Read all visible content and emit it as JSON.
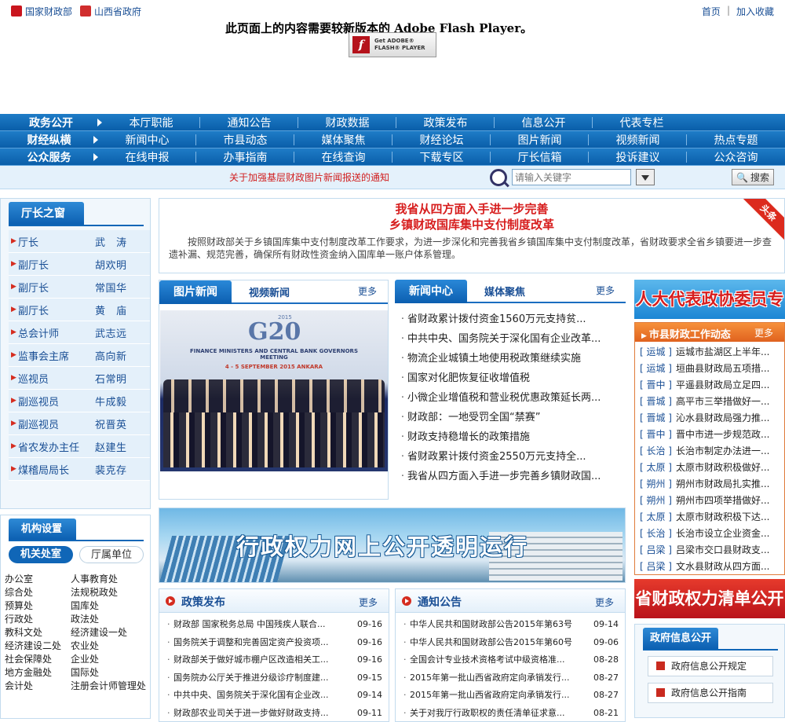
{
  "top": {
    "left_links": [
      "国家财政部",
      "山西省政府"
    ],
    "right_links": [
      "首页",
      "加入收藏"
    ],
    "separator": "|"
  },
  "flash": {
    "message": "此页面上的内容需要较新版本的 Adobe Flash Player。",
    "button_line1": "Get ADOBE®",
    "button_line2": "FLASH® PLAYER"
  },
  "nav": {
    "rows": [
      {
        "category": "政务公开",
        "items": [
          "本厅职能",
          "通知公告",
          "财政数据",
          "政策发布",
          "信息公开",
          "代表专栏"
        ]
      },
      {
        "category": "财经纵横",
        "items": [
          "新闻中心",
          "市县动态",
          "媒体聚焦",
          "财经论坛",
          "图片新闻",
          "视频新闻",
          "热点专题"
        ]
      },
      {
        "category": "公众服务",
        "items": [
          "在线申报",
          "办事指南",
          "在线查询",
          "下载专区",
          "厅长信箱",
          "投诉建议",
          "公众咨询"
        ]
      }
    ]
  },
  "search": {
    "notice": "关于加强基层财政图片新闻报送的通知",
    "placeholder": "请输入关键字",
    "button": "搜索"
  },
  "leaders": {
    "title": "厅长之窗",
    "rows": [
      {
        "role": "厅长",
        "name": "武　涛"
      },
      {
        "role": "副厅长",
        "name": "胡欢明"
      },
      {
        "role": "副厅长",
        "name": "常国华"
      },
      {
        "role": "副厅长",
        "name": "黄　庙"
      },
      {
        "role": "总会计师",
        "name": "武志远"
      },
      {
        "role": "监事会主席",
        "name": "高向新"
      },
      {
        "role": "巡视员",
        "name": "石常明"
      },
      {
        "role": "副巡视员",
        "name": "牛成毅"
      },
      {
        "role": "副巡视员",
        "name": "祝晋英"
      },
      {
        "role": "省农发办主任",
        "name": "赵建生"
      },
      {
        "role": "煤稽局局长",
        "name": "裴克存"
      }
    ]
  },
  "org": {
    "title": "机构设置",
    "tabs": [
      "机关处室",
      "厅属单位"
    ],
    "items": [
      "办公室",
      "人事教育处",
      "综合处",
      "法规税政处",
      "预算处",
      "国库处",
      "行政处",
      "政法处",
      "教科文处",
      "经济建设一处",
      "经济建设二处",
      "农业处",
      "社会保障处",
      "企业处",
      "地方金融处",
      "国际处",
      "会计处",
      "注册会计师管理处"
    ]
  },
  "headline": {
    "title1": "我省从四方面入手进一步完善",
    "title2": "乡镇财政国库集中支付制度改革",
    "body": "按照财政部关于乡镇国库集中支付制度改革工作要求，为进一步深化和完善我省乡镇国库集中支付制度改革，省财政要求全省乡镇要进一步查遗补漏、规范完善，确保所有财政性资金纳入国库单一账户体系管理。",
    "ribbon": "头条"
  },
  "pic_news": {
    "tab_active": "图片新闻",
    "tab_other": "视频新闻",
    "more": "更多",
    "photo_year": "2015",
    "photo_brand": "G20",
    "photo_caption1": "FINANCE MINISTERS AND CENTRAL BANK GOVERNORS MEETING",
    "photo_caption2": "4 - 5 SEPTEMBER 2015  ANKARA"
  },
  "news_center": {
    "tab_active": "新闻中心",
    "tab_other": "媒体聚焦",
    "more": "更多",
    "items": [
      "省财政累计拨付资金1560万元支持贫...",
      "中共中央、国务院关于深化国有企业改革...",
      "物流企业城镇土地使用税政策继续实施",
      "国家对化肥恢复征收增值税",
      "小微企业增值税和营业税优惠政策延长两...",
      "财政部：一地受罚全国“禁赛”",
      "财政支持稳增长的政策措施",
      "省财政累计拨付资金2550万元支持全...",
      "我省从四方面入手进一步完善乡镇财政国..."
    ]
  },
  "banner": {
    "text": "行政权力网上公开透明运行"
  },
  "policy": {
    "title": "政策发布",
    "more": "更多",
    "items": [
      {
        "title": "财政部 国家税务总局 中国残疾人联合...",
        "date": "09-16"
      },
      {
        "title": "国务院关于调整和完善固定资产投资项...",
        "date": "09-16"
      },
      {
        "title": "财政部关于做好城市棚户区改造相关工...",
        "date": "09-16"
      },
      {
        "title": "国务院办公厅关于推进分级诊疗制度建...",
        "date": "09-15"
      },
      {
        "title": "中共中央、国务院关于深化国有企业改...",
        "date": "09-14"
      },
      {
        "title": "财政部农业司关于进一步做好财政支持...",
        "date": "09-11"
      }
    ]
  },
  "notices": {
    "title": "通知公告",
    "more": "更多",
    "items": [
      {
        "title": "中华人民共和国财政部公告2015年第63号",
        "date": "09-14"
      },
      {
        "title": "中华人民共和国财政部公告2015年第60号",
        "date": "09-06"
      },
      {
        "title": "全国会计专业技术资格考试中级资格准...",
        "date": "08-28"
      },
      {
        "title": "2015年第一批山西省政府定向承销发行...",
        "date": "08-27"
      },
      {
        "title": "2015年第一批山西省政府定向承销发行...",
        "date": "08-27"
      },
      {
        "title": "关于对我厅行政职权的责任清单征求意...",
        "date": "08-21"
      }
    ]
  },
  "right": {
    "banner_top": "人大代表政协委员专栏",
    "county_title": "市县财政工作动态",
    "county_more": "更多",
    "county_items": [
      {
        "city": "运城",
        "title": "运城市盐湖区上半年..."
      },
      {
        "city": "运城",
        "title": "垣曲县财政局五项措..."
      },
      {
        "city": "晋中",
        "title": "平遥县财政局立足四..."
      },
      {
        "city": "晋城",
        "title": "高平市三举措做好一..."
      },
      {
        "city": "晋城",
        "title": "沁水县财政局强力推..."
      },
      {
        "city": "晋中",
        "title": "晋中市进一步规范政..."
      },
      {
        "city": "长治",
        "title": "长治市制定办法进一..."
      },
      {
        "city": "太原",
        "title": "太原市财政积极做好..."
      },
      {
        "city": "朔州",
        "title": "朔州市财政局扎实推..."
      },
      {
        "city": "朔州",
        "title": "朔州市四项举措做好..."
      },
      {
        "city": "太原",
        "title": "太原市财政积极下达..."
      },
      {
        "city": "长治",
        "title": "长治市设立企业资金..."
      },
      {
        "city": "吕梁",
        "title": "吕梁市交口县财政支..."
      },
      {
        "city": "吕梁",
        "title": "文水县财政从四方面..."
      }
    ],
    "banner_bottom": "省财政权力清单公开",
    "govinfo_title": "政府信息公开",
    "govinfo_items": [
      "政府信息公开规定",
      "政府信息公开指南"
    ]
  }
}
